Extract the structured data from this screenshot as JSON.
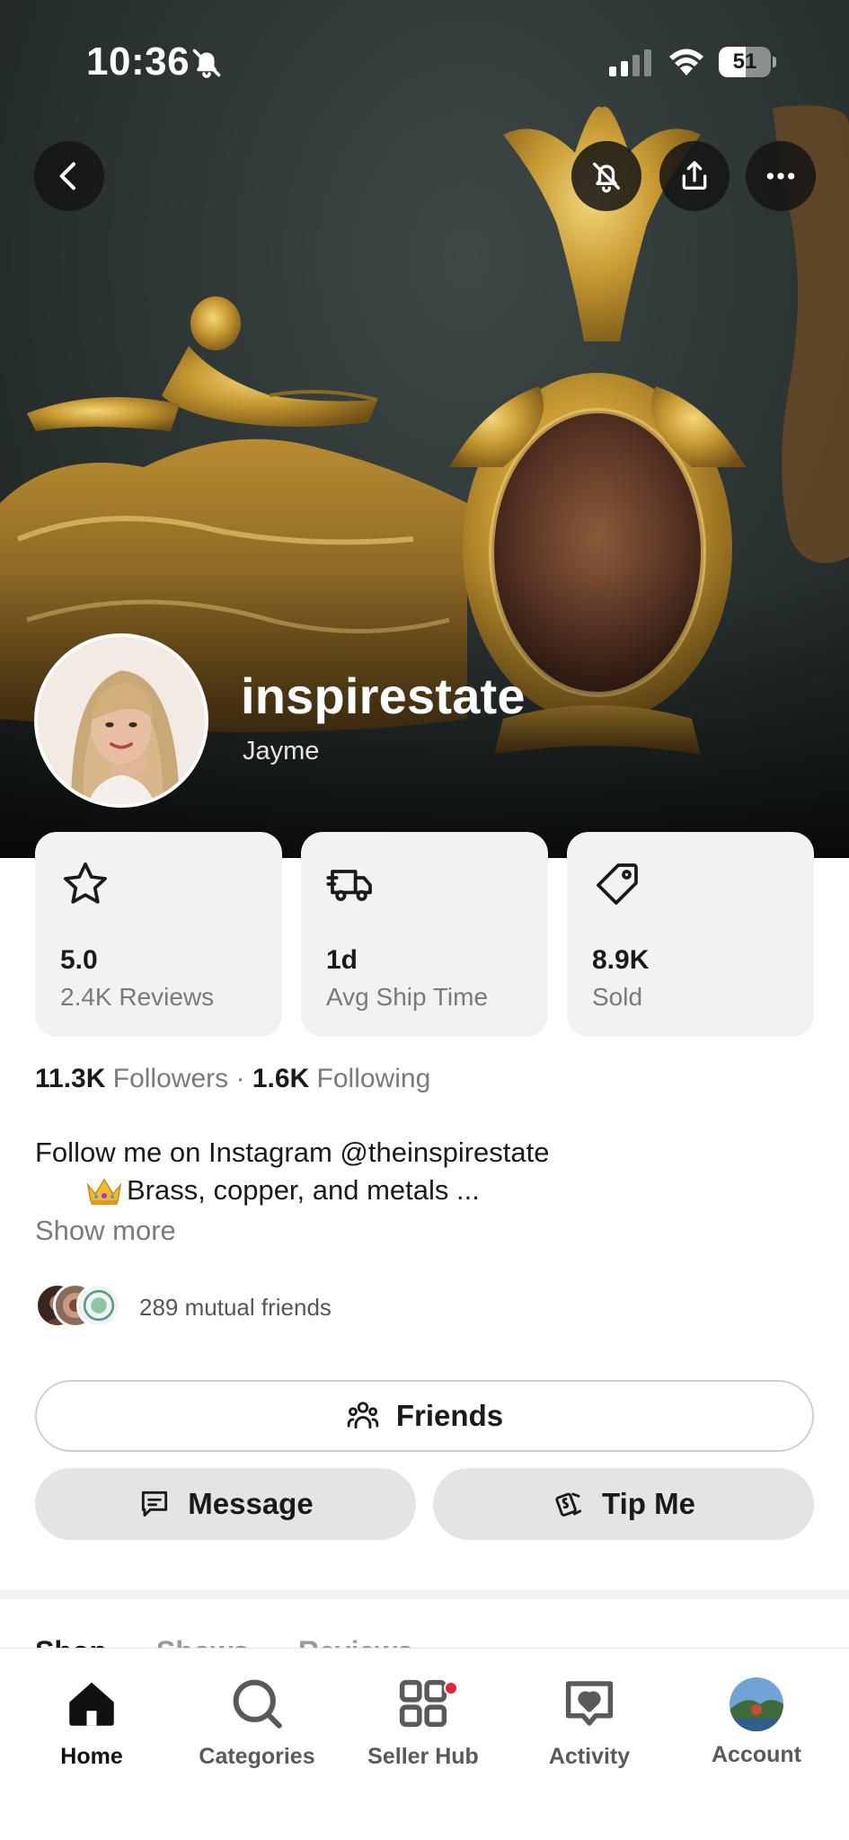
{
  "status_bar": {
    "time": "10:36",
    "battery": "51",
    "battery_level": 0.51
  },
  "header": {
    "back_icon": "chevron-left-icon",
    "mute_icon": "bell-off-icon",
    "share_icon": "share-icon",
    "more_icon": "more-horizontal-icon"
  },
  "profile": {
    "username": "inspirestate",
    "display_name": "Jayme"
  },
  "stats": [
    {
      "icon": "star-icon",
      "value": "5.0",
      "label": "2.4K Reviews"
    },
    {
      "icon": "truck-icon",
      "value": "1d",
      "label": "Avg Ship Time"
    },
    {
      "icon": "tag-icon",
      "value": "8.9K",
      "label": "Sold"
    }
  ],
  "follow": {
    "followers_count": "11.3K",
    "followers_label": "Followers",
    "separator": "·",
    "following_count": "1.6K",
    "following_label": "Following"
  },
  "bio": {
    "line1": "Follow me on Instagram @theinspirestate",
    "line2": "Brass, copper, and metals ...",
    "show_more": "Show more"
  },
  "mutual": {
    "text": "289 mutual friends"
  },
  "actions": {
    "friends": "Friends",
    "message": "Message",
    "tip": "Tip Me"
  },
  "section_tabs_peek": [
    "Shop",
    "Shows",
    "Reviews"
  ],
  "tab_bar": [
    {
      "label": "Home",
      "icon": "home-icon",
      "active": true
    },
    {
      "label": "Categories",
      "icon": "search-icon",
      "active": false
    },
    {
      "label": "Seller Hub",
      "icon": "grid-icon",
      "active": false,
      "badge": true
    },
    {
      "label": "Activity",
      "icon": "heart-message-icon",
      "active": false
    },
    {
      "label": "Account",
      "icon": "account-avatar",
      "active": false
    }
  ],
  "colors": {
    "card_bg": "#f2f2f2",
    "button_grey": "#e4e4e4",
    "badge_red": "#e8213a",
    "muted_text": "#7a7a7a",
    "gold": "#c9a23a"
  }
}
